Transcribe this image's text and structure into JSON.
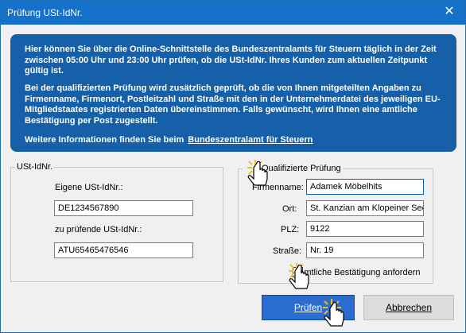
{
  "window": {
    "title": "Prüfung USt-IdNr.",
    "close_glyph": "✕"
  },
  "info": {
    "paragraph1": "Hier können Sie über die Online-Schnittstelle des Bundeszentralamts für Steuern täglich in der Zeit zwischen 05:00 Uhr und 23:00 Uhr prüfen, ob die USt-IdNr. Ihres Kunden zum aktuellen Zeitpunkt gültig ist.",
    "paragraph2": "Bei der qualifizierten Prüfung wird zusätzlich geprüft, ob die von Ihnen mitgeteilten Angaben zu Firmenname, Firmenort, Postleitzahl und Straße mit den in der Unternehmerdatei des jeweiligen EU-Mitgliedstaates registrierten Daten übereinstimmen. Falls gewünscht, wird Ihnen eine amtliche Bestätigung per Post zugestellt.",
    "more_info_text": "Weitere Informationen finden Sie beim",
    "more_info_link": "Bundeszentralamt für Steuern"
  },
  "ustid": {
    "group_label": "USt-IdNr.",
    "own_label": "Eigene USt-IdNr.:",
    "own_value": "DE1234567890",
    "check_label": "zu prüfende USt-IdNr.:",
    "check_value": "ATU65465476546"
  },
  "qualified": {
    "group_label": "Qualifizierte Prüfung",
    "company_label": "Firmenname:",
    "company_value": "Adamek Möbelhits",
    "city_label": "Ort:",
    "city_value": "St. Kanzian am Klopeiner See",
    "zip_label": "PLZ:",
    "zip_value": "9122",
    "street_label": "Straße:",
    "street_value": "Nr. 19",
    "confirm_label": "Amtliche Bestätigung anfordern",
    "confirm_checked": false
  },
  "buttons": {
    "check_label": "Prüfen",
    "cancel_label": "Abbrechen"
  },
  "colors": {
    "titlebar": "#1470c8",
    "info_box": "#1560a8",
    "primary_button": "#2a6cd0",
    "cursor_highlight": "#f0c020"
  },
  "icons": [
    "close-icon",
    "hand-cursor-icon"
  ]
}
